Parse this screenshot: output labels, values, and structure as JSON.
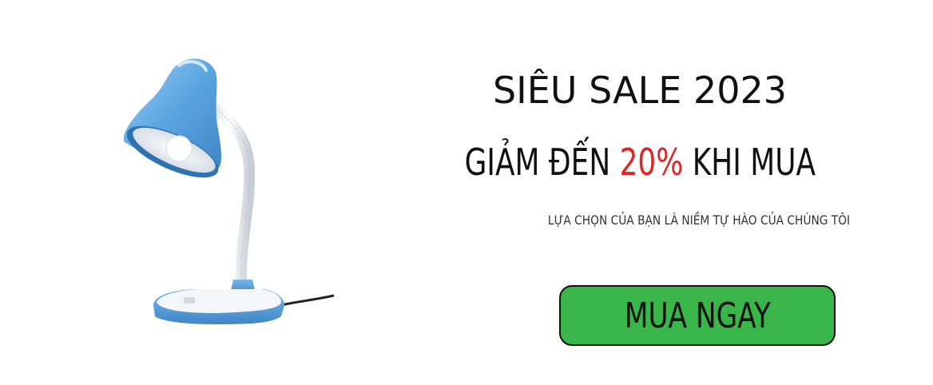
{
  "banner": {
    "headline_line1": "SIÊU SALE 2023",
    "headline_line2_prefix": "GIẢM ĐẾN ",
    "headline_line2_accent": "20%",
    "headline_line2_suffix": " KHI MUA",
    "tagline": "LỰA CHỌN CỦA BẠN LÀ NIỀM TỰ HÀO CỦA CHÚNG TÔI",
    "cta_label": "MUA NGAY"
  },
  "colors": {
    "accent": "#e02424",
    "cta_background": "#39b54a",
    "lamp_blue": "#5aa4e0"
  },
  "product": {
    "icon": "desk-lamp-icon"
  }
}
